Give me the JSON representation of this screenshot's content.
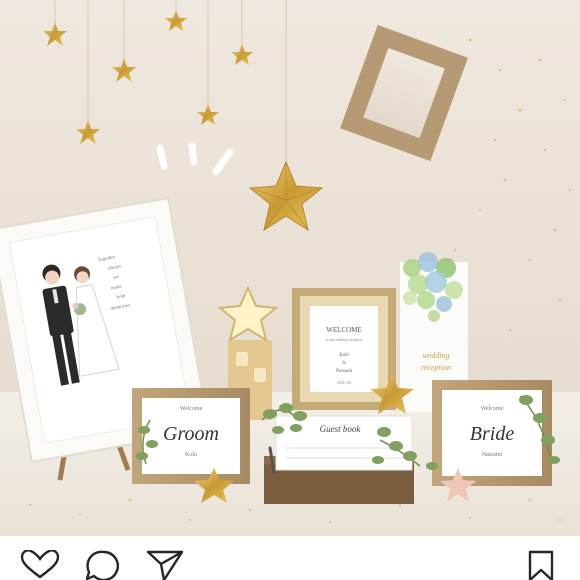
{
  "post": {
    "photo_alt": "Wedding welcome table",
    "illustration_text": [
      "Together",
      "always",
      "we",
      "make",
      "both",
      "memories"
    ],
    "welcome_board": {
      "title": "WELCOME",
      "subtitle": "to our wedding reception",
      "name1": "Koki",
      "amp": "&",
      "name2": "Natsumi",
      "date": "2018.10.8"
    },
    "reception_card": {
      "line1": "wedding",
      "line2": "reception"
    },
    "groom_card": {
      "welcome": "Welcome",
      "title": "Groom",
      "name": "Koki"
    },
    "bride_card": {
      "welcome": "Welcome",
      "title": "Bride",
      "name": "Natsumi"
    },
    "guest_book": {
      "title": "Guest book"
    }
  },
  "actions": {
    "like_icon": "heart-icon",
    "comment_icon": "comment-icon",
    "share_icon": "send-icon",
    "save_icon": "bookmark-icon"
  },
  "colors": {
    "wall": "#e9e1d6",
    "gold": "#d7b04a",
    "wood": "#a6855c"
  }
}
